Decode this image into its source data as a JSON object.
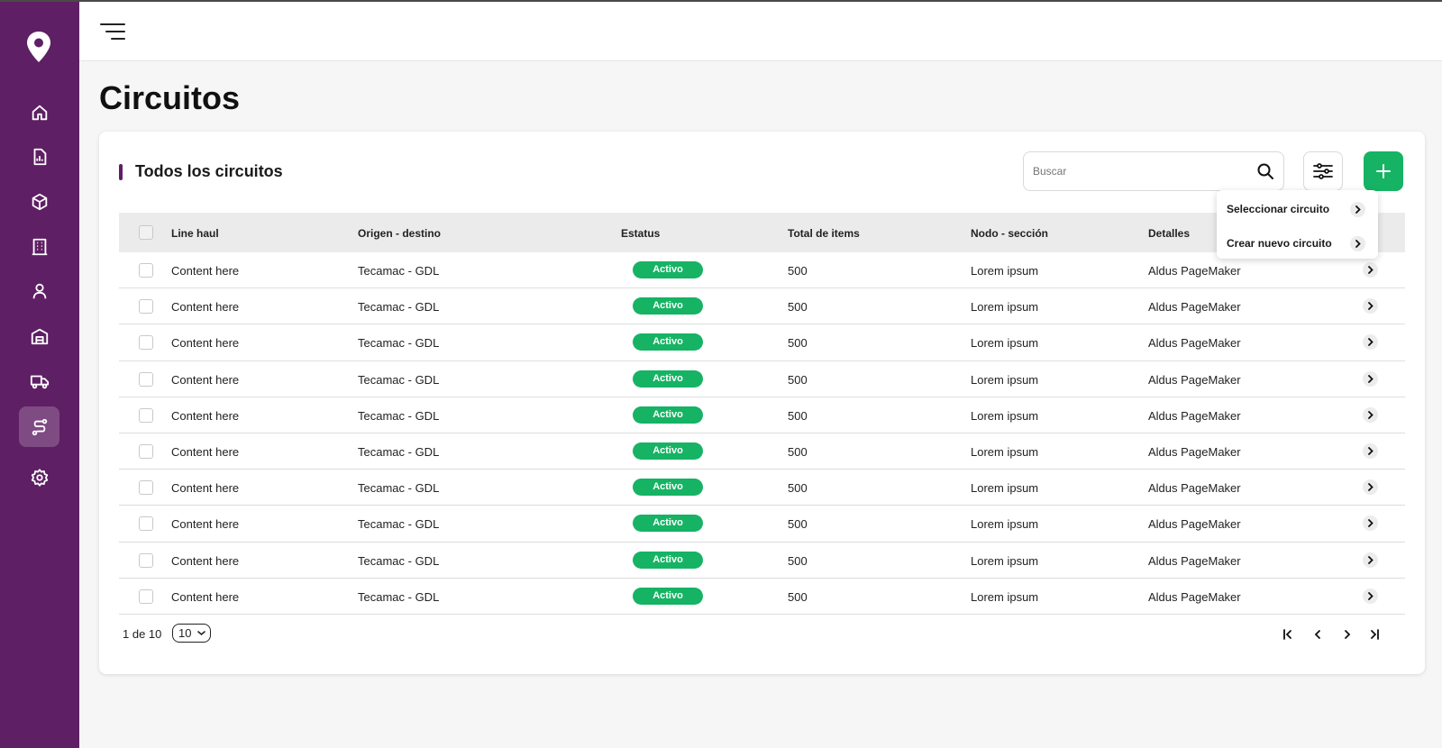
{
  "page": {
    "title": "Circuitos"
  },
  "card": {
    "title": "Todos los circuitos"
  },
  "search": {
    "placeholder": "Buscar"
  },
  "colors": {
    "brand": "#5f1f64",
    "accent": "#16b364"
  },
  "sidebar": {
    "items": [
      {
        "icon": "home-icon",
        "active": false
      },
      {
        "icon": "report-icon",
        "active": false
      },
      {
        "icon": "box-icon",
        "active": false
      },
      {
        "icon": "building-icon",
        "active": false
      },
      {
        "icon": "user-icon",
        "active": false
      },
      {
        "icon": "warehouse-icon",
        "active": false
      },
      {
        "icon": "truck-icon",
        "active": false
      },
      {
        "icon": "route-icon",
        "active": true
      },
      {
        "icon": "gear-icon",
        "active": false
      }
    ]
  },
  "table": {
    "headers": [
      "Line haul",
      "Origen - destino",
      "Estatus",
      "Total de items",
      "Nodo - sección",
      "Detalles"
    ],
    "rows": [
      {
        "line_haul": "Content here",
        "origin": "Tecamac - GDL",
        "status": "Activo",
        "total": "500",
        "node": "Lorem ipsum",
        "details": "Aldus PageMaker"
      },
      {
        "line_haul": "Content here",
        "origin": "Tecamac - GDL",
        "status": "Activo",
        "total": "500",
        "node": "Lorem ipsum",
        "details": "Aldus PageMaker"
      },
      {
        "line_haul": "Content here",
        "origin": "Tecamac - GDL",
        "status": "Activo",
        "total": "500",
        "node": "Lorem ipsum",
        "details": "Aldus PageMaker"
      },
      {
        "line_haul": "Content here",
        "origin": "Tecamac - GDL",
        "status": "Activo",
        "total": "500",
        "node": "Lorem ipsum",
        "details": "Aldus PageMaker"
      },
      {
        "line_haul": "Content here",
        "origin": "Tecamac - GDL",
        "status": "Activo",
        "total": "500",
        "node": "Lorem ipsum",
        "details": "Aldus PageMaker"
      },
      {
        "line_haul": "Content here",
        "origin": "Tecamac - GDL",
        "status": "Activo",
        "total": "500",
        "node": "Lorem ipsum",
        "details": "Aldus PageMaker"
      },
      {
        "line_haul": "Content here",
        "origin": "Tecamac - GDL",
        "status": "Activo",
        "total": "500",
        "node": "Lorem ipsum",
        "details": "Aldus PageMaker"
      },
      {
        "line_haul": "Content here",
        "origin": "Tecamac - GDL",
        "status": "Activo",
        "total": "500",
        "node": "Lorem ipsum",
        "details": "Aldus PageMaker"
      },
      {
        "line_haul": "Content here",
        "origin": "Tecamac - GDL",
        "status": "Activo",
        "total": "500",
        "node": "Lorem ipsum",
        "details": "Aldus PageMaker"
      },
      {
        "line_haul": "Content here",
        "origin": "Tecamac - GDL",
        "status": "Activo",
        "total": "500",
        "node": "Lorem ipsum",
        "details": "Aldus PageMaker"
      }
    ]
  },
  "dropdown": {
    "items": [
      "Seleccionar circuito",
      "Crear nuevo circuito"
    ]
  },
  "pagination": {
    "info": "1 de 10",
    "page_size": "10"
  }
}
